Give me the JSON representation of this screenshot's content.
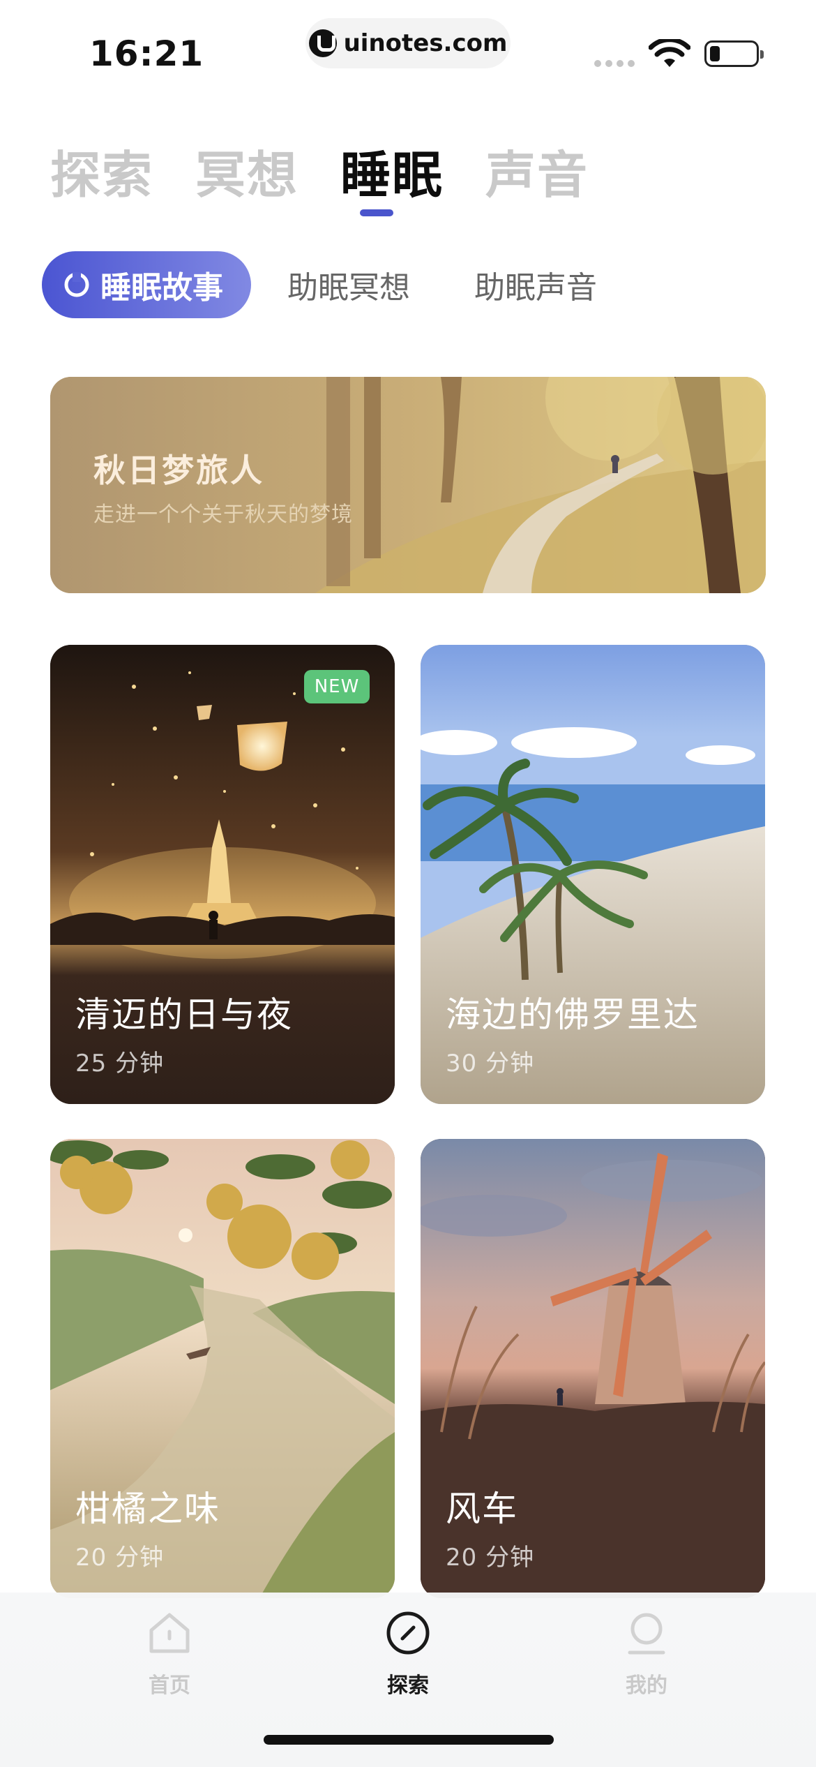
{
  "status_bar": {
    "time": "16:21",
    "url": "uinotes.com"
  },
  "main_tabs": [
    {
      "label": "探索",
      "active": false
    },
    {
      "label": "冥想",
      "active": false
    },
    {
      "label": "睡眠",
      "active": true
    },
    {
      "label": "声音",
      "active": false
    }
  ],
  "sub_tabs": [
    {
      "label": "睡眠故事",
      "active": true,
      "icon": "moon-icon"
    },
    {
      "label": "助眠冥想",
      "active": false
    },
    {
      "label": "助眠声音",
      "active": false
    }
  ],
  "banner": {
    "title": "秋日梦旅人",
    "subtitle": "走进一个个关于秋天的梦境"
  },
  "cards": [
    {
      "title": "清迈的日与夜",
      "duration": "25 分钟",
      "badge": "NEW"
    },
    {
      "title": "海边的佛罗里达",
      "duration": "30 分钟"
    },
    {
      "title": "柑橘之味",
      "duration": "20 分钟"
    },
    {
      "title": "风车",
      "duration": "20 分钟"
    }
  ],
  "bottom_nav": [
    {
      "label": "首页",
      "icon": "home-icon",
      "active": false
    },
    {
      "label": "探索",
      "icon": "compass-icon",
      "active": true
    },
    {
      "label": "我的",
      "icon": "profile-icon",
      "active": false
    }
  ],
  "colors": {
    "accent": "#4a55cc",
    "badge": "#5cc47a"
  }
}
